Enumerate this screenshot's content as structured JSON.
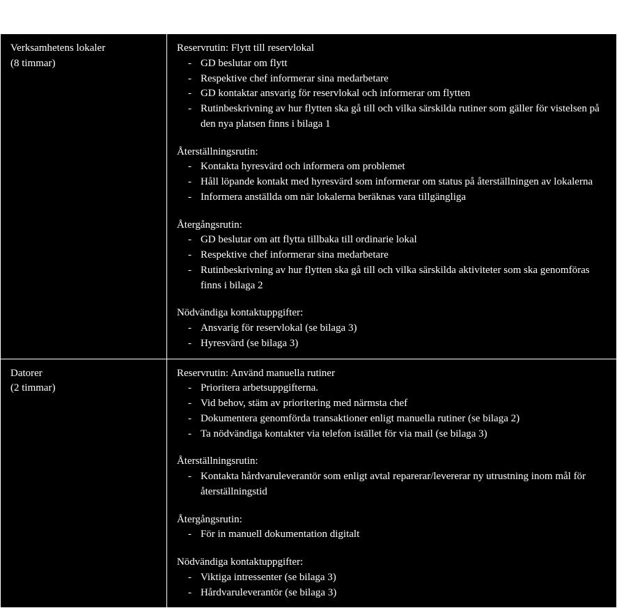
{
  "rows": [
    {
      "label": "Verksamhetens lokaler",
      "time": "(8 timmar)",
      "sections": [
        {
          "heading": "Reservrutin: Flytt till reservlokal",
          "items": [
            "GD beslutar om flytt",
            "Respektive chef informerar sina medarbetare",
            "GD kontaktar ansvarig för reservlokal och informerar om flytten",
            "Rutinbeskrivning av hur flytten ska gå till och vilka särskilda rutiner som gäller för vistelsen på den nya platsen finns i bilaga 1"
          ]
        },
        {
          "heading": "Återställningsrutin:",
          "items": [
            "Kontakta hyresvärd och informera om problemet",
            "Håll löpande kontakt med hyresvärd som informerar om status på återställningen av lokalerna",
            "Informera anställda om när lokalerna beräknas vara tillgängliga"
          ]
        },
        {
          "heading": "Återgångsrutin:",
          "items": [
            "GD beslutar om att flytta tillbaka till ordinarie lokal",
            "Respektive chef informerar sina medarbetare",
            "Rutinbeskrivning av hur flytten ska gå till och vilka särskilda aktiviteter som ska genomföras finns i bilaga 2"
          ]
        },
        {
          "heading": "Nödvändiga kontaktuppgifter:",
          "items": [
            "Ansvarig för reservlokal (se bilaga 3)",
            "Hyresvärd (se bilaga 3)"
          ]
        }
      ]
    },
    {
      "label": "Datorer",
      "time": "(2 timmar)",
      "sections": [
        {
          "heading": "Reservrutin: Använd manuella rutiner",
          "items": [
            "Prioritera arbetsuppgifterna.",
            "Vid behov, stäm av prioritering med närmsta chef",
            "Dokumentera genomförda transaktioner enligt manuella rutiner (se bilaga 2)",
            "Ta nödvändiga kontakter via telefon istället för via mail (se bilaga 3)"
          ]
        },
        {
          "heading": "Återställningsrutin:",
          "items": [
            "Kontakta hårdvaruleverantör som enligt avtal reparerar/levererar ny utrustning inom mål för återställningstid"
          ]
        },
        {
          "heading": "Återgångsrutin:",
          "items": [
            "För in manuell dokumentation digitalt"
          ]
        },
        {
          "heading": "Nödvändiga kontaktuppgifter:",
          "items": [
            "Viktiga intressenter (se bilaga 3)",
            "Hårdvaruleverantör (se bilaga 3)"
          ]
        }
      ]
    }
  ]
}
